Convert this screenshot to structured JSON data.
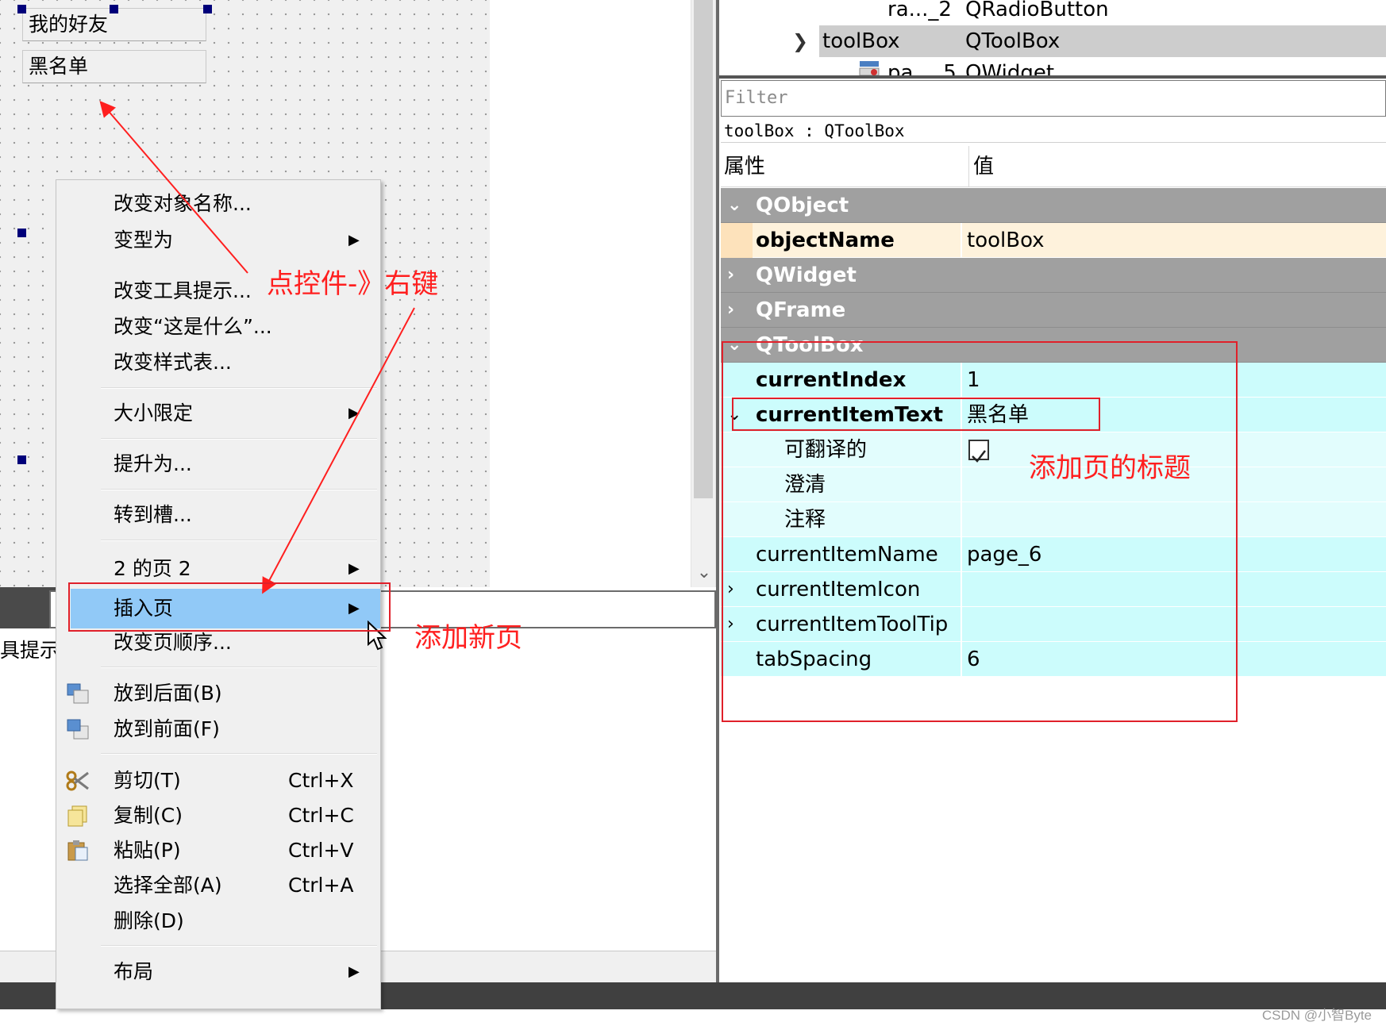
{
  "canvas": {
    "toolbox_pages": [
      "我的好友",
      "黑名单"
    ]
  },
  "bottom_left": {
    "label": "具提示"
  },
  "object_inspector": {
    "rows": [
      {
        "name": "ra..._2",
        "class": "QRadioButton"
      },
      {
        "name": "toolBox",
        "class": "QToolBox"
      },
      {
        "name": "pa..._5",
        "class": "QWidget"
      }
    ]
  },
  "property_editor": {
    "filter_placeholder": "Filter",
    "object_label": "toolBox : QToolBox",
    "header": {
      "property": "属性",
      "value": "值"
    },
    "groups": {
      "qobject": "QObject",
      "qwidget": "QWidget",
      "qframe": "QFrame",
      "qtoolbox": "QToolBox"
    },
    "props": {
      "objectName": {
        "name": "objectName",
        "value": "toolBox"
      },
      "currentIndex": {
        "name": "currentIndex",
        "value": "1"
      },
      "currentItemText": {
        "name": "currentItemText",
        "value": "黑名单"
      },
      "translatable": {
        "name": "可翻译的",
        "checked": true
      },
      "disambiguation": {
        "name": "澄清",
        "value": ""
      },
      "comment": {
        "name": "注释",
        "value": ""
      },
      "currentItemName": {
        "name": "currentItemName",
        "value": "page_6"
      },
      "currentItemIcon": {
        "name": "currentItemIcon",
        "value": ""
      },
      "currentItemToolTip": {
        "name": "currentItemToolTip",
        "value": ""
      },
      "tabSpacing": {
        "name": "tabSpacing",
        "value": "6"
      }
    }
  },
  "context_menu": {
    "items": {
      "change_object_name": "改变对象名称...",
      "morph_into": "变型为",
      "change_tooltip": "改变工具提示...",
      "change_whats_this": "改变“这是什么”...",
      "change_stylesheet": "改变样式表...",
      "size_constraints": "大小限定",
      "promote_to": "提升为...",
      "go_to_slot": "转到槽...",
      "page_of": "2 的页 2",
      "insert_page": "插入页",
      "change_page_order": "改变页顺序...",
      "send_to_back": "放到后面(B)",
      "bring_to_front": "放到前面(F)",
      "cut": "剪切(T)",
      "cut_shortcut": "Ctrl+X",
      "copy": "复制(C)",
      "copy_shortcut": "Ctrl+C",
      "paste": "粘贴(P)",
      "paste_shortcut": "Ctrl+V",
      "select_all": "选择全部(A)",
      "select_all_shortcut": "Ctrl+A",
      "delete": "删除(D)",
      "layout": "布局"
    }
  },
  "annotations": {
    "right_click_note": "点控件-》右键",
    "add_page_note": "添加新页",
    "page_title_note": "添加页的标题"
  },
  "watermark": "CSDN @小智Byte",
  "colors": {
    "annotation_red": "#ff1f1f",
    "menu_highlight": "#91c9f7",
    "toolbox_group_cyan": "#ccfcfc",
    "objectname_peach": "#fef2dc",
    "group_header_gray": "#a0a0a0"
  },
  "icons": {
    "submenu_arrow": "chevron-right-icon",
    "send_to_back": "send-to-back-icon",
    "bring_to_front": "bring-to-front-icon",
    "cut": "scissors-icon",
    "copy": "copy-icon",
    "paste": "paste-icon",
    "widget": "widget-icon"
  }
}
